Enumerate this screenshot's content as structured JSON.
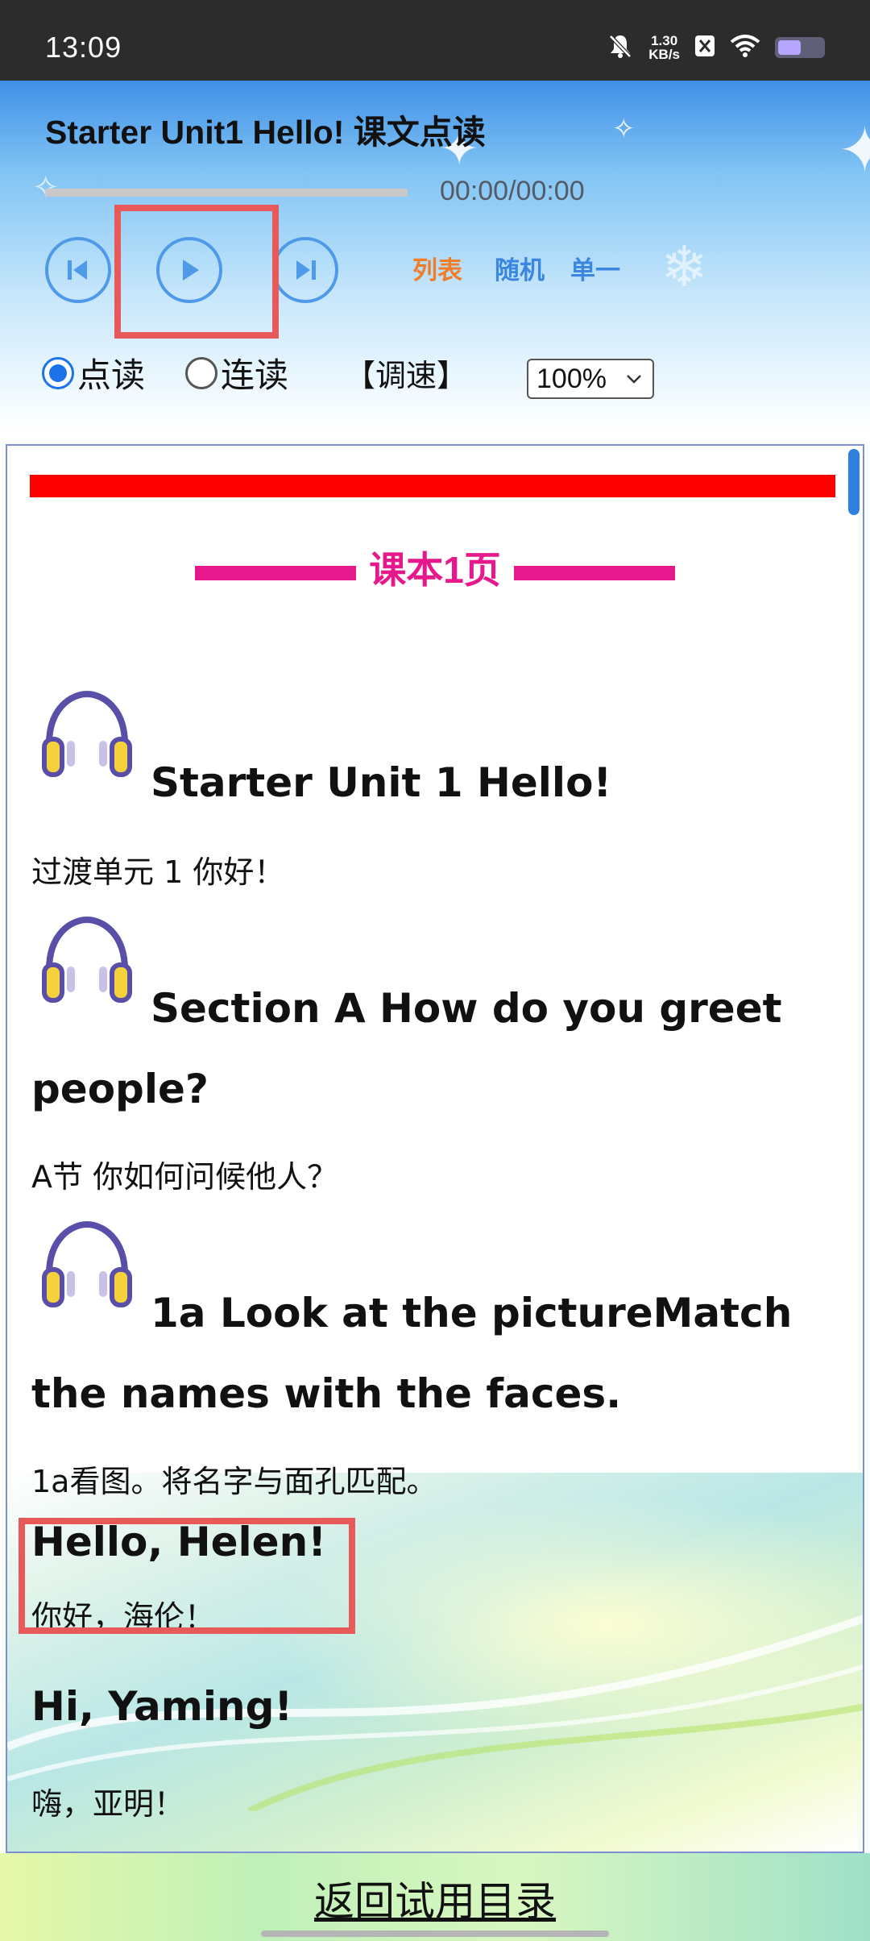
{
  "status_bar": {
    "time": "13:09",
    "net_speed_value": "1.30",
    "net_speed_unit": "KB/s",
    "icons": [
      "mute-bell-icon",
      "x-app-icon",
      "wifi-icon",
      "battery-icon"
    ]
  },
  "player": {
    "title": "Starter Unit1 Hello! 课文点读",
    "time_readout": "00:00/00:00",
    "progress": 0,
    "controls": [
      "prev-icon",
      "play-icon",
      "next-icon"
    ],
    "modes": {
      "list": "列表",
      "random": "随机",
      "single": "单一"
    },
    "read_mode": {
      "point_read": "点读",
      "continuous_read": "连读",
      "selected": "point_read"
    },
    "speed_label": "【调速】",
    "speed_value": "100%"
  },
  "content": {
    "page_heading": "课本1页",
    "items": [
      {
        "en": "Starter Unit 1 Hello!",
        "cn": "过渡单元 1 你好！",
        "has_audio_icon": true
      },
      {
        "en": "Section A How do you greet people?",
        "cn": "A节 你如何问候他人？",
        "has_audio_icon": true
      },
      {
        "en": "1a Look at the pictureMatch the names with the faces.",
        "cn": "1a看图。将名字与面孔匹配。",
        "has_audio_icon": true
      },
      {
        "en": "Hello, Helen!",
        "cn": "你好，海伦！",
        "has_audio_icon": false
      },
      {
        "en": "Hi, Yaming!",
        "cn": "嗨，亚明！",
        "has_audio_icon": false
      }
    ]
  },
  "footer": {
    "link": "返回试用目录"
  },
  "colors": {
    "accent_blue": "#4f9ae8",
    "heading_pink": "#e6198c",
    "highlight_red": "#e85a5a",
    "bar_red": "#ff0000",
    "mode_orange": "#f07d2a",
    "mode_blue": "#3a86e0"
  }
}
